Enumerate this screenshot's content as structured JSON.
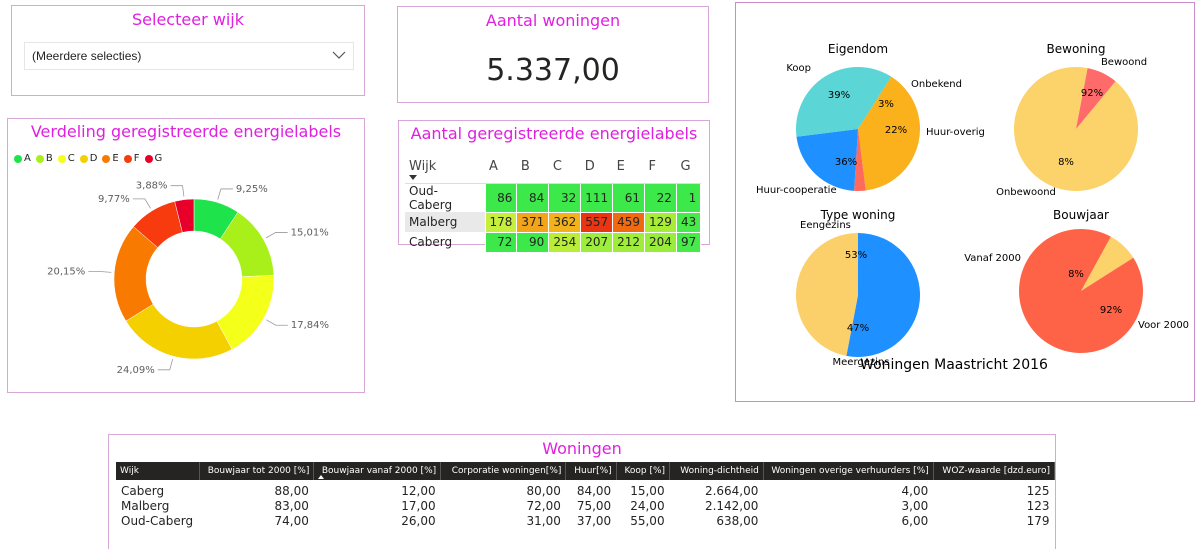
{
  "slicer": {
    "title": "Selecteer wijk",
    "value": "(Meerdere selecties)",
    "icon": "chevron-down-icon"
  },
  "kpi": {
    "title": "Aantal woningen",
    "value": "5.337,00"
  },
  "donut": {
    "title": "Verdeling geregistreerde energielabels",
    "legend": [
      {
        "label": "A",
        "color": "#1fe34a"
      },
      {
        "label": "B",
        "color": "#a9f01a"
      },
      {
        "label": "C",
        "color": "#f4ff1a"
      },
      {
        "label": "D",
        "color": "#f5d000"
      },
      {
        "label": "E",
        "color": "#f87a00"
      },
      {
        "label": "F",
        "color": "#f83a0f"
      },
      {
        "label": "G",
        "color": "#e8002b"
      }
    ]
  },
  "chart_data": {
    "type": "pie",
    "variant": "donut",
    "categories": [
      "A",
      "B",
      "C",
      "D",
      "E",
      "F",
      "G"
    ],
    "values": [
      9.25,
      15.01,
      17.84,
      24.09,
      20.15,
      9.77,
      3.88
    ],
    "labels": [
      "9,25%",
      "15,01%",
      "17,84%",
      "24,09%",
      "20,15%",
      "9,77%",
      "3,88%"
    ],
    "legend": "top-left"
  },
  "matrix": {
    "title": "Aantal geregistreerde energielabels",
    "row_header": "Wijk",
    "columns": [
      "A",
      "B",
      "C",
      "D",
      "E",
      "F",
      "G"
    ],
    "rows": [
      {
        "label": "Oud-Caberg",
        "values": [
          "86",
          "84",
          "32",
          "111",
          "61",
          "22",
          "1"
        ],
        "colors": [
          "#3de84a",
          "#3de84a",
          "#3de84a",
          "#3de84a",
          "#3de84a",
          "#3de84a",
          "#3de84a"
        ]
      },
      {
        "label": "Malberg",
        "values": [
          "178",
          "371",
          "362",
          "557",
          "459",
          "129",
          "43"
        ],
        "colors": [
          "#c6ee3c",
          "#f2a51a",
          "#f2b21c",
          "#e83512",
          "#ef6a10",
          "#a8ec3a",
          "#48e94a"
        ]
      },
      {
        "label": "Caberg",
        "values": [
          "72",
          "90",
          "254",
          "207",
          "212",
          "204",
          "97"
        ],
        "colors": [
          "#3de84a",
          "#3de84a",
          "#b9ed3a",
          "#9ded3c",
          "#a0ec3c",
          "#9aec3c",
          "#48e94a"
        ]
      }
    ]
  },
  "pies": {
    "suptitle": "Woningen Maastricht 2016",
    "charts": [
      {
        "title": "Eigendom",
        "labels": [
          "Koop",
          "Onbekend",
          "Huur-overig",
          "Huur-cooperatie"
        ],
        "pcts": [
          "39%",
          "3%",
          "22%",
          "36%"
        ],
        "values": [
          39,
          3,
          22,
          36
        ],
        "colors": [
          "#fbb11c",
          "#ff6a5c",
          "#1e90ff",
          "#5bd5d5"
        ]
      },
      {
        "title": "Bewoning",
        "labels": [
          "Bewoond",
          "Onbewoond"
        ],
        "pcts": [
          "92%",
          "8%"
        ],
        "values": [
          92,
          8
        ],
        "colors": [
          "#fcd26a",
          "#ff6a6a"
        ]
      },
      {
        "title": "Type woning",
        "labels": [
          "Eengezins",
          "Meergezins"
        ],
        "pcts": [
          "53%",
          "47%"
        ],
        "values": [
          53,
          47
        ],
        "colors": [
          "#1e90ff",
          "#fbd06a"
        ]
      },
      {
        "title": "Bouwjaar",
        "labels": [
          "Vanaf 2000",
          "Voor 2000"
        ],
        "pcts": [
          "8%",
          "92%"
        ],
        "values": [
          8,
          92
        ],
        "colors": [
          "#fcd26a",
          "#ff6347"
        ]
      }
    ]
  },
  "woningen": {
    "title": "Woningen",
    "headers": [
      "Wijk",
      "Bouwjaar tot 2000 [%]",
      "Bouwjaar vanaf 2000 [%]",
      "Corporatie woningen[%]",
      "Huur[%]",
      "Koop [%]",
      "Woning-dichtheid",
      "Woningen overige verhuurders [%]",
      "WOZ-waarde [dzd.euro]"
    ],
    "rows": [
      [
        "Caberg",
        "88,00",
        "12,00",
        "80,00",
        "84,00",
        "15,00",
        "2.664,00",
        "4,00",
        "125"
      ],
      [
        "Malberg",
        "83,00",
        "17,00",
        "72,00",
        "75,00",
        "24,00",
        "2.142,00",
        "3,00",
        "123"
      ],
      [
        "Oud-Caberg",
        "74,00",
        "26,00",
        "31,00",
        "37,00",
        "55,00",
        "638,00",
        "6,00",
        "179"
      ]
    ]
  }
}
